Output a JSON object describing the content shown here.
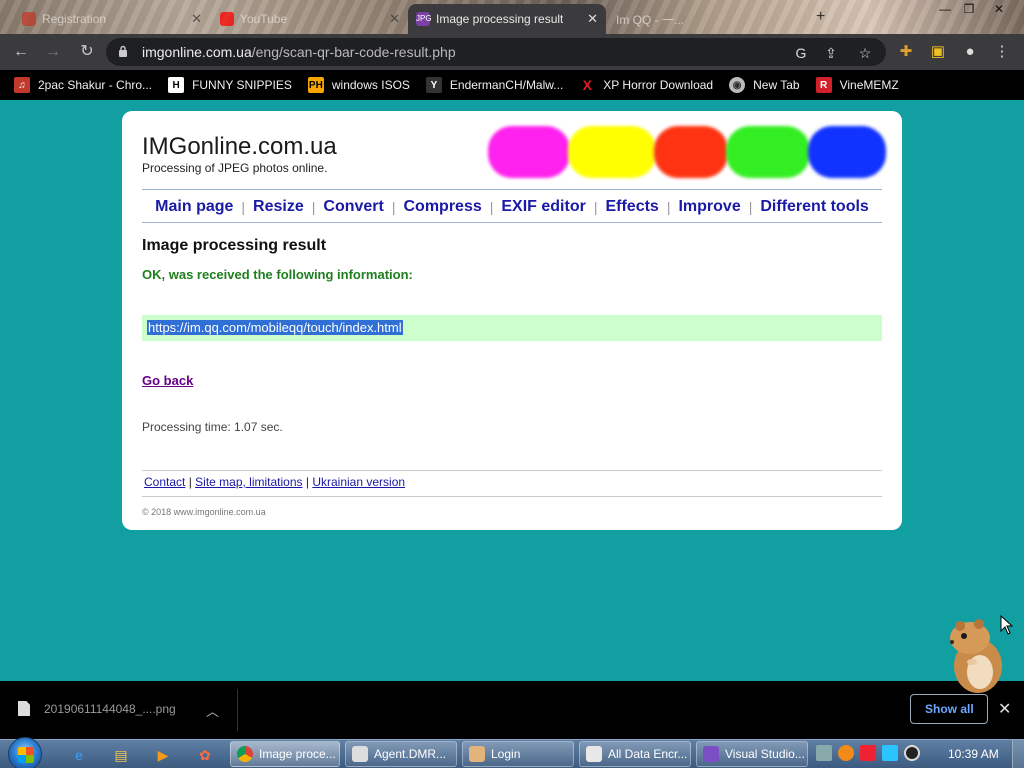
{
  "browser": {
    "tabs": [
      {
        "title": "Registration",
        "active": false
      },
      {
        "title": "YouTube",
        "active": false
      },
      {
        "title": "Image processing result",
        "active": true
      },
      {
        "title": "Im QQ - 一...",
        "active": false
      }
    ],
    "url_domain": "imgonline.com.ua",
    "url_path": "/eng/scan-qr-bar-code-result.php",
    "bookmarks": [
      {
        "label": "2pac Shakur - Chro..."
      },
      {
        "label": "FUNNY SNIPPIES"
      },
      {
        "label": "windows ISOS"
      },
      {
        "label": "EndermanCH/Malw..."
      },
      {
        "label": "XP Horror Download"
      },
      {
        "label": "New Tab"
      },
      {
        "label": "VineMEMZ"
      }
    ]
  },
  "page": {
    "site_title": "IMGonline.com.ua",
    "site_subtitle": "Processing of JPEG photos online.",
    "nav": [
      "Main page",
      "Resize",
      "Convert",
      "Compress",
      "EXIF editor",
      "Effects",
      "Improve",
      "Different tools"
    ],
    "heading": "Image processing result",
    "status": "OK, was received the following information:",
    "result_text": "https://im.qq.com/mobileqq/touch/index.html",
    "go_back": "Go back",
    "processing_time": "Processing time: 1.07 sec.",
    "footer_links": [
      "Contact",
      "Site map, limitations",
      "Ukrainian version"
    ],
    "copyright": "© 2018 www.imgonline.com.ua",
    "blob_colors": [
      "#ff22ee",
      "#ffff00",
      "#ff3311",
      "#33ee22",
      "#1133ff"
    ]
  },
  "downloads": {
    "filename": "20190611144048_....png",
    "show_all": "Show all"
  },
  "taskbar": {
    "items": [
      {
        "label": "Image proce...",
        "active": true
      },
      {
        "label": "Agent.DMR...",
        "active": false
      },
      {
        "label": "Login",
        "active": false
      },
      {
        "label": "All Data Encr...",
        "active": false
      },
      {
        "label": "Visual Studio...",
        "active": false
      }
    ],
    "clock": "10:39 AM"
  }
}
